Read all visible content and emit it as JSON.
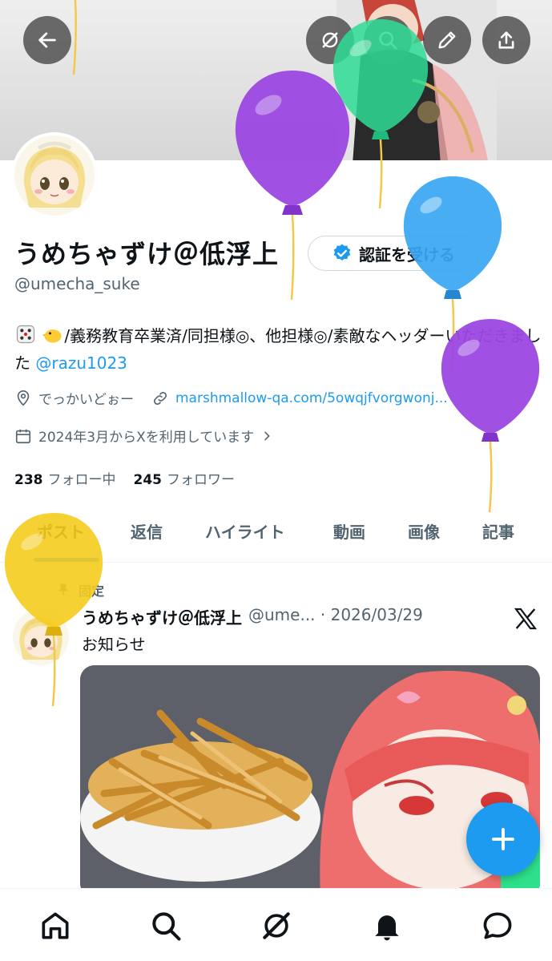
{
  "profile": {
    "display_name": "うめちゃずけ＠低浮上",
    "handle": "@umecha_suke",
    "verify_label": "認証を受ける",
    "bio_text": "/義務教育卒業済/同担様◎、他担様◎/素敵なヘッダーいただきました",
    "bio_mention": "@razu1023",
    "location": "でっかいどぉー",
    "website": "marshmallow-qa.com/5owqjfvorgwonj...",
    "joined": "2024年3月からXを利用しています",
    "following_count": "238",
    "following_label": "フォロー中",
    "followers_count": "245",
    "followers_label": "フォロワー"
  },
  "tabs": [
    {
      "label": "ポスト"
    },
    {
      "label": "返信"
    },
    {
      "label": "ハイライト"
    },
    {
      "label": "動画"
    },
    {
      "label": "画像"
    },
    {
      "label": "記事"
    }
  ],
  "pinned_post": {
    "pinned_label": "固定",
    "author": "うめちゃずけ＠低浮上",
    "meta": "@ume... · 2026/03/29",
    "text": "お知らせ"
  },
  "icons": {
    "top": [
      "back-arrow-icon",
      "grok-icon",
      "search-icon",
      "edit-icon",
      "share-icon"
    ],
    "bottom": [
      "home-icon",
      "search-icon",
      "grok-icon",
      "bell-icon",
      "messages-icon"
    ]
  },
  "colors": {
    "accent": "#1d9bf0",
    "balloon_purple": "#9b47e0",
    "balloon_green": "#2fdc96",
    "balloon_blue": "#3aa6f2",
    "balloon_yellow": "#f5cc1e"
  }
}
